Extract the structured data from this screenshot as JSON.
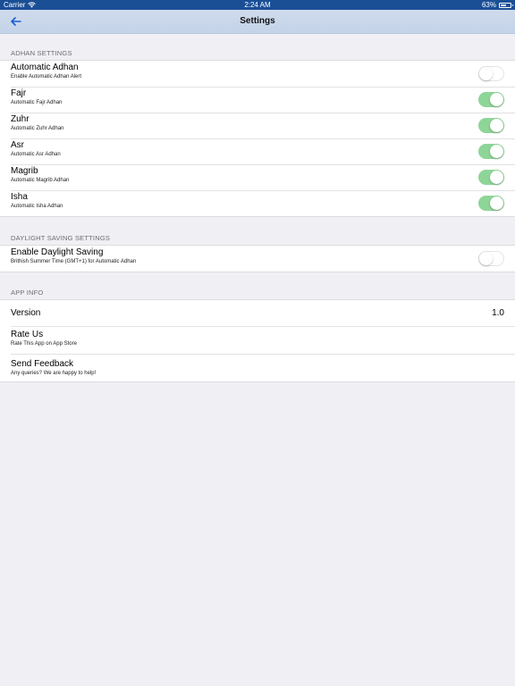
{
  "status_bar": {
    "carrier": "Carrier",
    "wifi_icon": "wifi-icon",
    "time": "2:24 AM",
    "battery_percent": "63%",
    "battery_level": 0.63
  },
  "nav": {
    "back_icon": "back-arrow-icon",
    "title": "Settings"
  },
  "colors": {
    "status_bar": "#1a4f96",
    "nav_bar": "#c8d6ea",
    "accent": "#1a5fd6",
    "toggle_on": "#8ed598",
    "background": "#efeff4"
  },
  "sections": {
    "adhan": {
      "header": "ADHAN SETTINGS",
      "rows": [
        {
          "title": "Automatic Adhan",
          "subtitle": "Enable Automatic Adhan Alert",
          "toggle_on": false
        },
        {
          "title": "Fajr",
          "subtitle": "Automatic Fajr Adhan",
          "toggle_on": true
        },
        {
          "title": "Zuhr",
          "subtitle": "Automatic Zuhr Adhan",
          "toggle_on": true
        },
        {
          "title": "Asr",
          "subtitle": "Automatic Asr Adhan",
          "toggle_on": true
        },
        {
          "title": "Magrib",
          "subtitle": "Automatic Magrib Adhan",
          "toggle_on": true
        },
        {
          "title": "Isha",
          "subtitle": "Automatic Isha Adhan",
          "toggle_on": true
        }
      ]
    },
    "daylight": {
      "header": "DAYLIGHT SAVING SETTINGS",
      "rows": [
        {
          "title": "Enable Daylight Saving",
          "subtitle": "Brithish Summer Time (GMT+1) for Automatic Adhan",
          "toggle_on": false
        }
      ]
    },
    "app_info": {
      "header": "APP INFO",
      "version": {
        "title": "Version",
        "value": "1.0"
      },
      "rate": {
        "title": "Rate Us",
        "subtitle": "Rate This App on App Store"
      },
      "feedback": {
        "title": "Send Feedback",
        "subtitle": "Any queries? We are happy to help!"
      }
    }
  }
}
